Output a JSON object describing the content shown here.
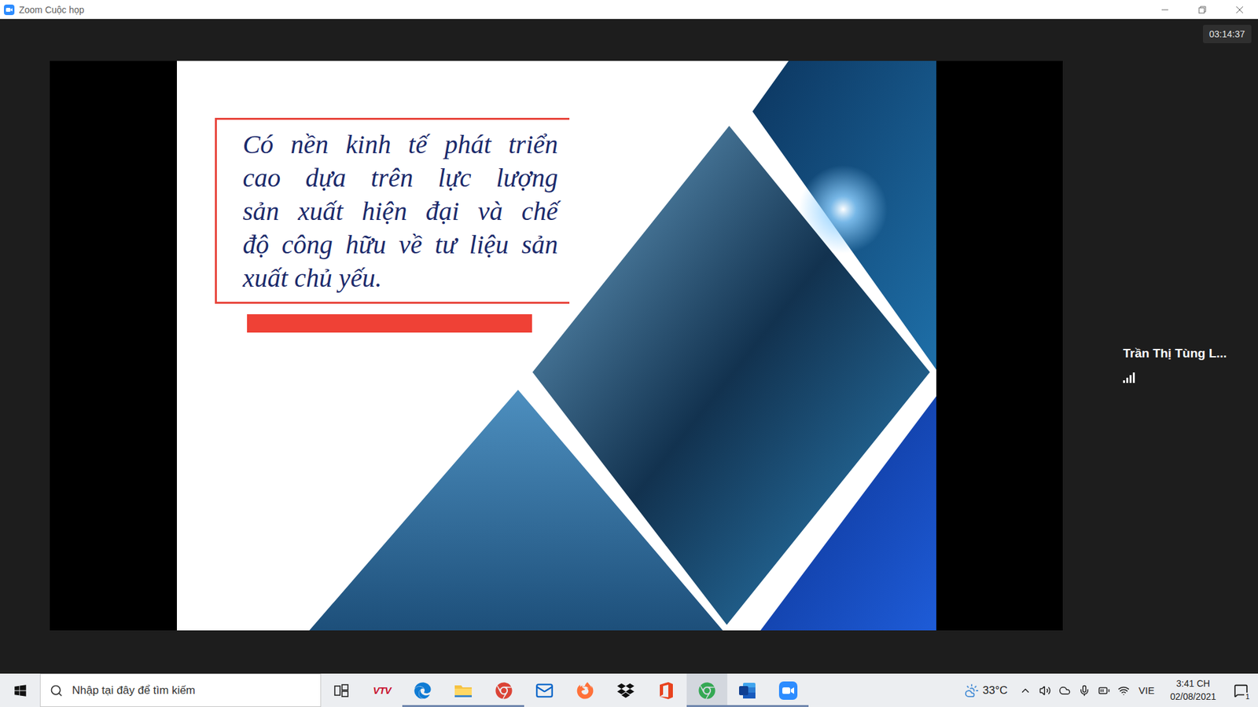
{
  "window": {
    "title": "Zoom Cuộc họp"
  },
  "meeting": {
    "timer": "03:14:37"
  },
  "participant": {
    "name": "Trần Thị Tùng L...",
    "level": 1
  },
  "slide": {
    "lines": [
      "Có nền kinh tế phát triển",
      "cao dựa trên lực lượng",
      "sản xuất hiện đại và chế",
      "độ công hữu về tư liệu sản",
      "xuất chủ yếu."
    ]
  },
  "taskbar": {
    "search": {
      "placeholder": "Nhập tại đây để tìm kiếm"
    },
    "apps": [
      {
        "running": false,
        "selected": false,
        "label": "VTV"
      },
      {
        "running": true,
        "selected": false
      },
      {
        "running": true,
        "selected": false
      },
      {
        "running": true,
        "selected": false
      },
      {
        "running": false,
        "selected": false
      },
      {
        "running": false,
        "selected": false
      },
      {
        "running": false,
        "selected": false
      },
      {
        "running": false,
        "selected": false
      },
      {
        "running": true,
        "selected": true
      },
      {
        "running": true,
        "selected": false
      },
      {
        "running": true,
        "selected": false
      }
    ],
    "tray": {
      "temperature": "33°C",
      "language": "VIE",
      "time": "3:41 CH",
      "date": "02/08/2021",
      "notifications": "1"
    }
  }
}
